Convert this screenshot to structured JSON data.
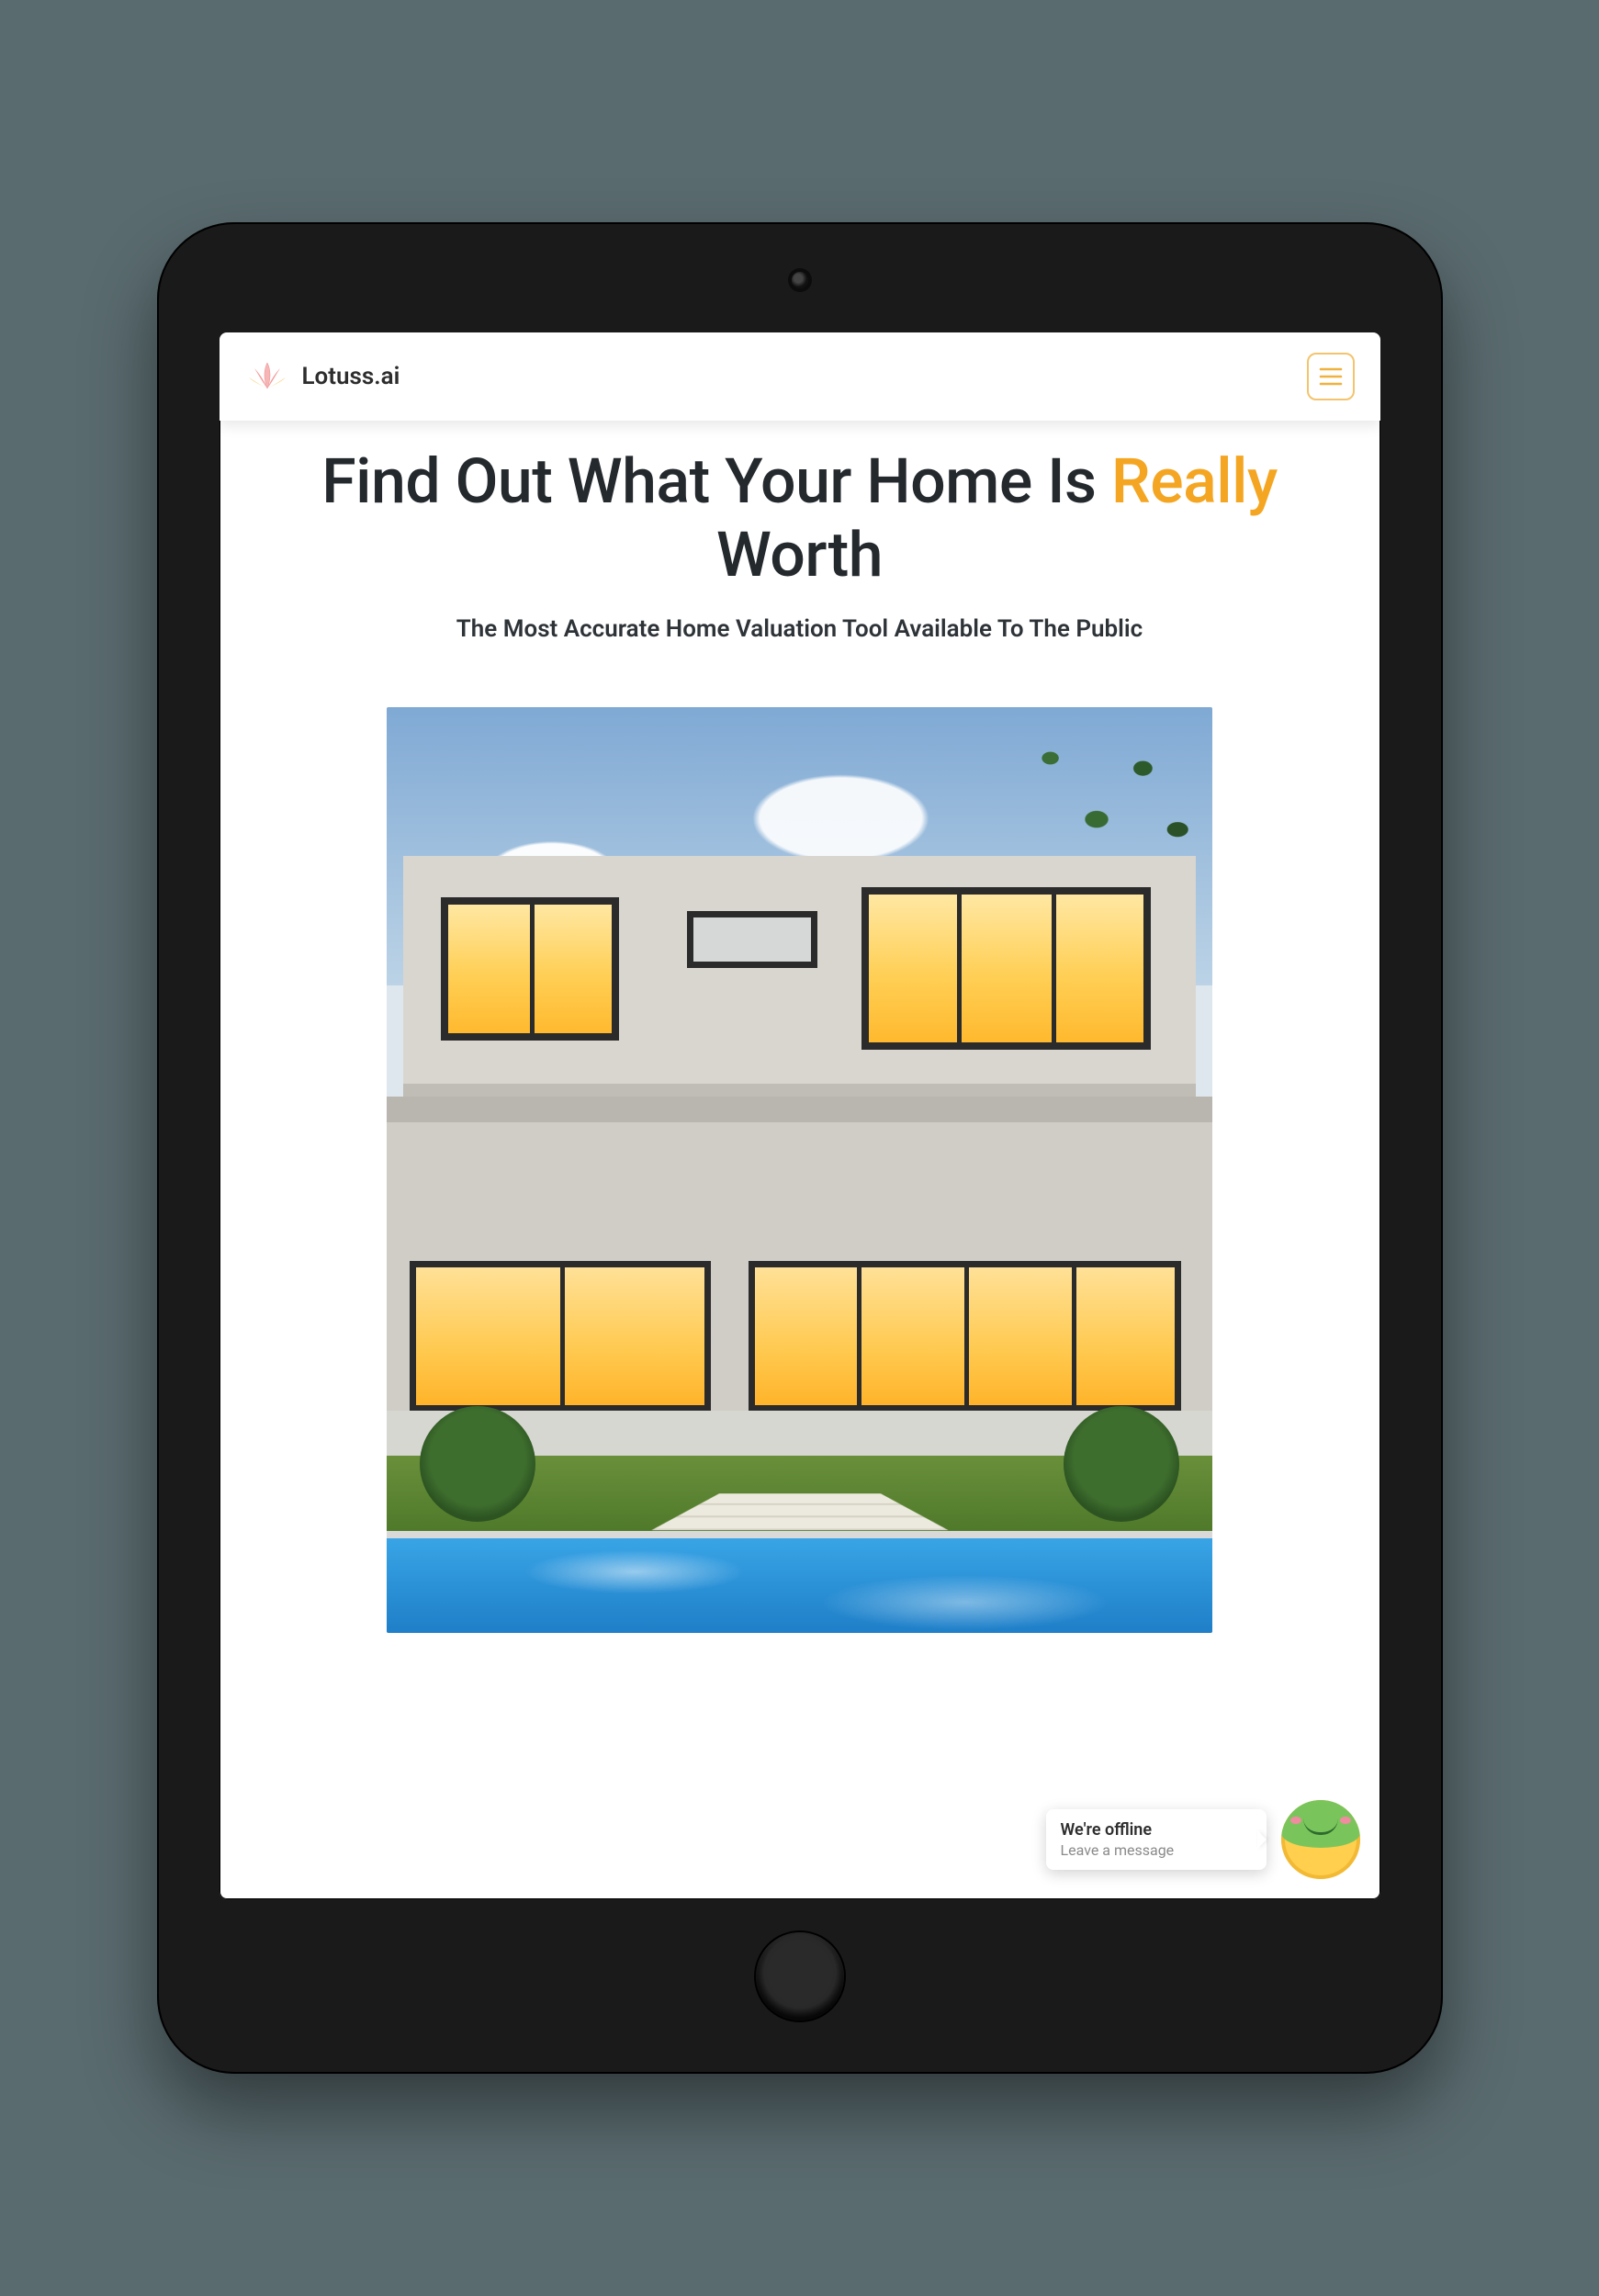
{
  "brand": {
    "name": "Lotuss.ai"
  },
  "hero": {
    "title_pre": "Find Out What Your Home Is ",
    "title_accent": "Really",
    "title_post": " Worth",
    "subtitle": "The Most Accurate Home Valuation Tool Available To The Public"
  },
  "chat": {
    "title": "We're offline",
    "subtitle": "Leave a message"
  },
  "colors": {
    "accent": "#f4a623"
  }
}
